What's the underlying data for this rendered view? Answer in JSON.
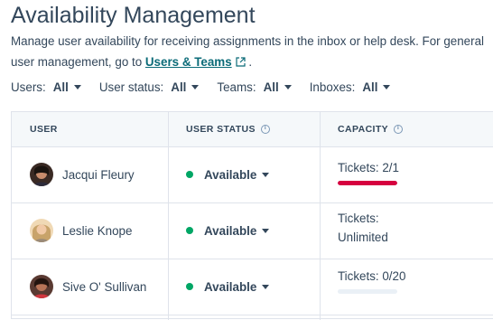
{
  "page": {
    "title": "Availability Management",
    "description_1": "Manage user availability for receiving assignments in the inbox or help desk. For general user management, go to ",
    "description_link": "Users & Teams",
    "description_2": " ."
  },
  "filters": [
    {
      "label": "Users:",
      "value": "All"
    },
    {
      "label": "User status:",
      "value": "All"
    },
    {
      "label": "Teams:",
      "value": "All"
    },
    {
      "label": "Inboxes:",
      "value": "All"
    }
  ],
  "table": {
    "headers": {
      "user": "USER",
      "status": "USER STATUS",
      "capacity": "CAPACITY"
    },
    "rows": [
      {
        "name": "Jacqui Fleury",
        "status": "Available",
        "capacity_line1": "Tickets: 2/1",
        "capacity_line2": "",
        "capacity_fraction": 1.0,
        "bar_color": "#d6003f"
      },
      {
        "name": "Leslie Knope",
        "status": "Available",
        "capacity_line1": "Tickets:",
        "capacity_line2": "Unlimited",
        "capacity_fraction": null,
        "bar_color": ""
      },
      {
        "name": "Sive O' Sullivan",
        "status": "Available",
        "capacity_line1": "Tickets: 0/20",
        "capacity_line2": "",
        "capacity_fraction": 0.0,
        "bar_color": "#eaf0f6"
      }
    ]
  },
  "colors": {
    "link": "#0b6b78",
    "status_available": "#00a665",
    "over_capacity": "#d6003f",
    "text": "#33475b"
  }
}
